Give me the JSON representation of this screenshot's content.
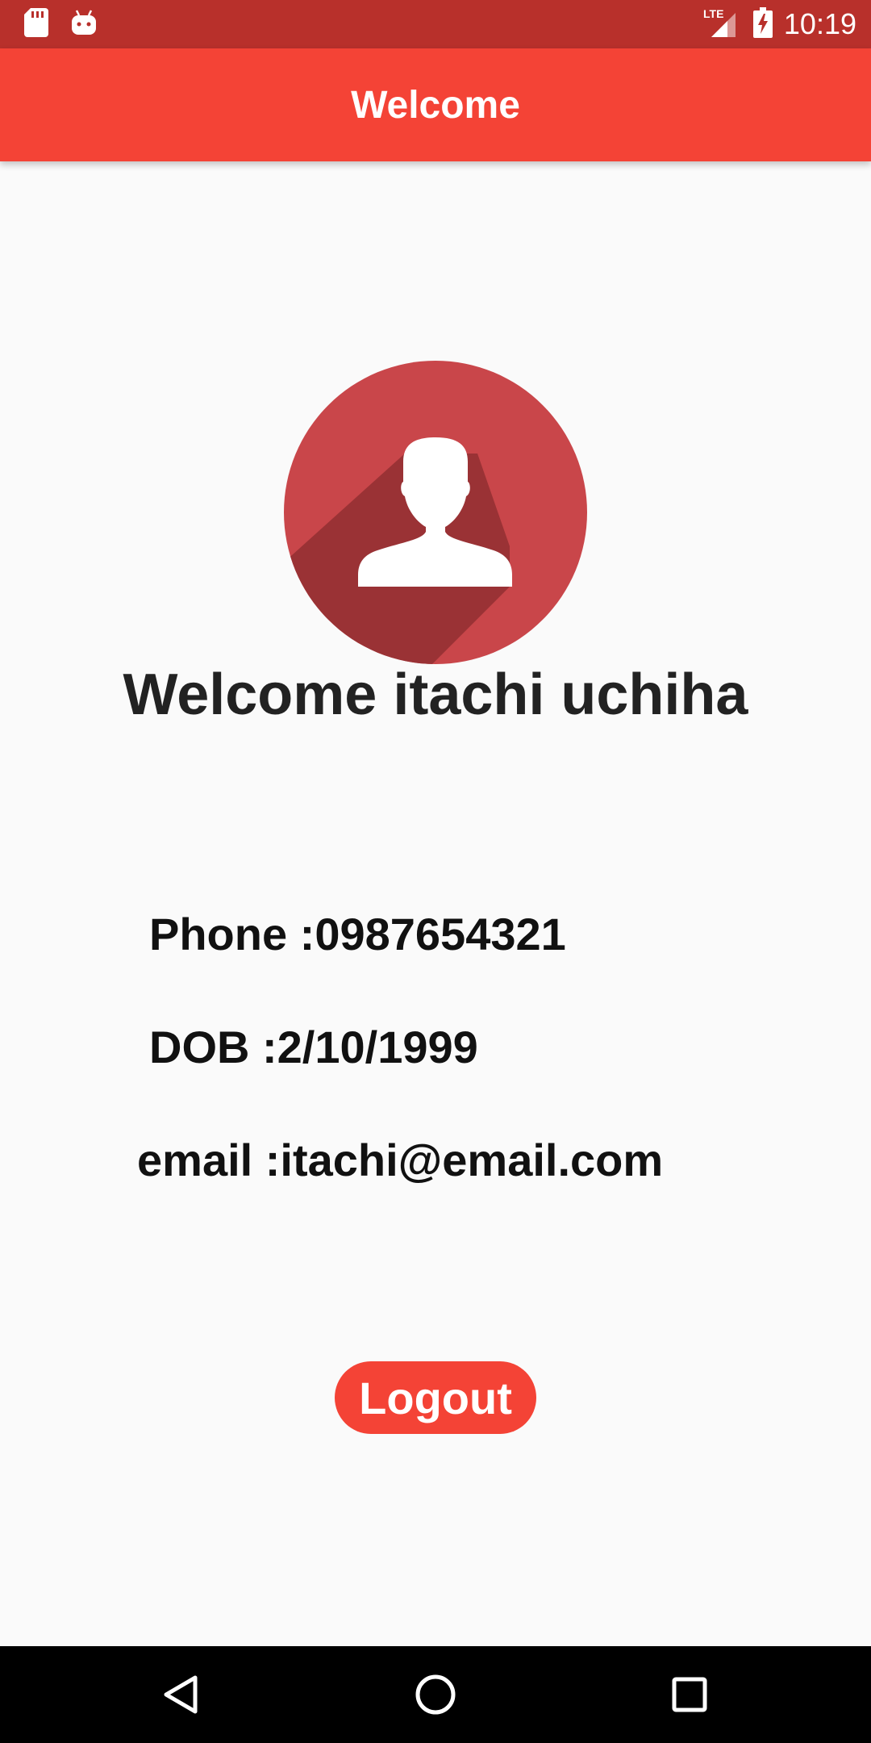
{
  "status_bar": {
    "time": "10:19",
    "network": "LTE",
    "left_icons": [
      "sd-card-icon",
      "android-debug-icon"
    ],
    "right_icons": [
      "lte-signal-icon",
      "battery-charging-icon"
    ]
  },
  "app_bar": {
    "title": "Welcome"
  },
  "profile": {
    "avatar_icon": "user-silhouette-icon",
    "welcome_text": "Welcome itachi uchiha",
    "phone_text": "Phone :0987654321",
    "dob_text": "DOB :2/10/1999",
    "email_text": "email :itachi@email.com"
  },
  "actions": {
    "logout_label": "Logout"
  },
  "nav_bar": {
    "icons": [
      "back-icon",
      "home-icon",
      "recents-icon"
    ]
  },
  "colors": {
    "status_bar": "#b8302b",
    "app_bar": "#f44336",
    "avatar_circle": "#c9464a",
    "avatar_shadow": "#9a3235",
    "background": "#fafafa",
    "logout_button": "#f44336"
  }
}
